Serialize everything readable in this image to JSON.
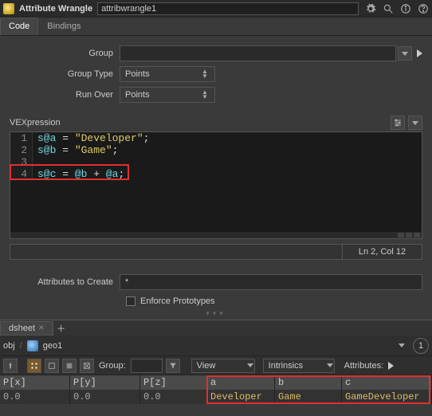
{
  "titlebar": {
    "title": "Attribute Wrangle",
    "node_name": "attribwrangle1"
  },
  "tabs": {
    "code": "Code",
    "bindings": "Bindings"
  },
  "params": {
    "group_label": "Group",
    "group_value": "",
    "group_type_label": "Group Type",
    "group_type_value": "Points",
    "run_over_label": "Run Over",
    "run_over_value": "Points"
  },
  "vex": {
    "label": "VEXpression",
    "lines": {
      "l1_attr": "s@a",
      "l1_rest": " = ",
      "l1_str": "\"Developer\"",
      "l1_end": ";",
      "l2_attr": "s@b",
      "l2_rest": " = ",
      "l2_str": "\"Game\"",
      "l2_end": ";",
      "l4_c": "s@c",
      "l4_eq": " = ",
      "l4_b": "@b",
      "l4_plus": " + ",
      "l4_a": "@a",
      "l4_end": ";"
    },
    "status": "Ln 2, Col 12"
  },
  "attrs_create": {
    "label": "Attributes to Create",
    "value": "*"
  },
  "enforce": {
    "label": "Enforce Prototypes"
  },
  "sheet": {
    "tab_name": "dsheet",
    "crumb_obj": "obj",
    "crumb_geo": "geo1",
    "group_label": "Group:",
    "view_label": "View",
    "intrinsics_label": "Intrinsics",
    "attributes_label": "Attributes:",
    "one": "1",
    "head": {
      "px": "P[x]",
      "py": "P[y]",
      "pz": "P[z]",
      "a": "a",
      "b": "b",
      "c": "c"
    },
    "row0": {
      "px": "0.0",
      "py": "0.0",
      "pz": "0.0",
      "a": "Developer",
      "b": "Game",
      "c": "GameDeveloper"
    }
  }
}
